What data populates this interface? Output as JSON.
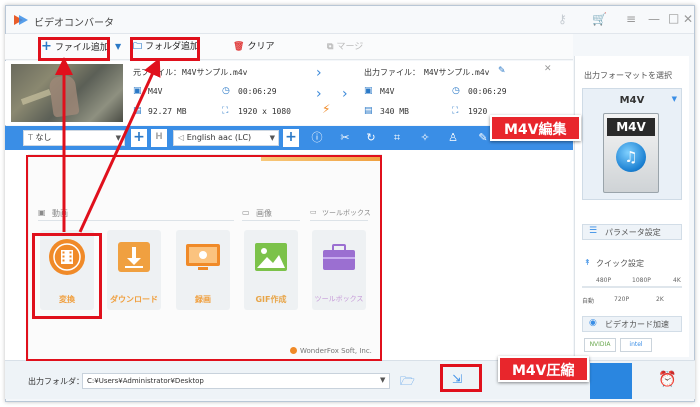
{
  "window": {
    "title": "ビデオコンバータ"
  },
  "titlebar_icons": [
    "key-icon",
    "cart-icon",
    "menu-icon",
    "minimize-icon",
    "maximize-icon",
    "close-icon"
  ],
  "toolbar": {
    "add_file": "ファイル追加",
    "add_folder": "フォルダ追加",
    "clear": "クリア",
    "merge": "マージ"
  },
  "file": {
    "source_label": "元ファイル：",
    "source_name": "M4Vサンプル.m4v",
    "src_format": "M4V",
    "src_duration": "00:06:29",
    "src_size": "92.27 MB",
    "src_resolution": "1920 x 1080",
    "output_label": "出力ファイル：",
    "output_name": "M4Vサンプル.m4v",
    "out_format": "M4V",
    "out_duration": "00:06:29",
    "out_size": "340 MB",
    "out_resolution": "1920"
  },
  "edit_bar": {
    "subtitle": "なし",
    "audio": "English aac (LC)"
  },
  "menu": {
    "cat_video": "動画",
    "cat_image": "画像",
    "cat_toolbox": "ツールボックス",
    "tiles": [
      "変換",
      "ダウンロード",
      "録画",
      "GIF作成",
      "ツールボックス"
    ],
    "brand": "WonderFox Soft, Inc."
  },
  "right_panel": {
    "title": "出力フォーマットを選択",
    "format": "M4V",
    "icon_label": "M4V",
    "params": "パラメータ設定",
    "quick": "クイック設定",
    "q480": "480P",
    "q1080": "1080P",
    "q4k": "4K",
    "qauto": "自動",
    "q720": "720P",
    "q2k": "2K",
    "gpu": "ビデオカード加速",
    "nvidia": "NVIDIA",
    "intel": "intel"
  },
  "bottom": {
    "output_folder_label": "出力フォルダ：",
    "path": "C:¥Users¥Administrator¥Desktop"
  },
  "annotations": {
    "edit": "M4V編集",
    "compress": "M4V圧縮"
  },
  "colors": {
    "accent": "#3a8ee6",
    "annotation": "#e0101c",
    "tile_text": "#f0a040"
  }
}
